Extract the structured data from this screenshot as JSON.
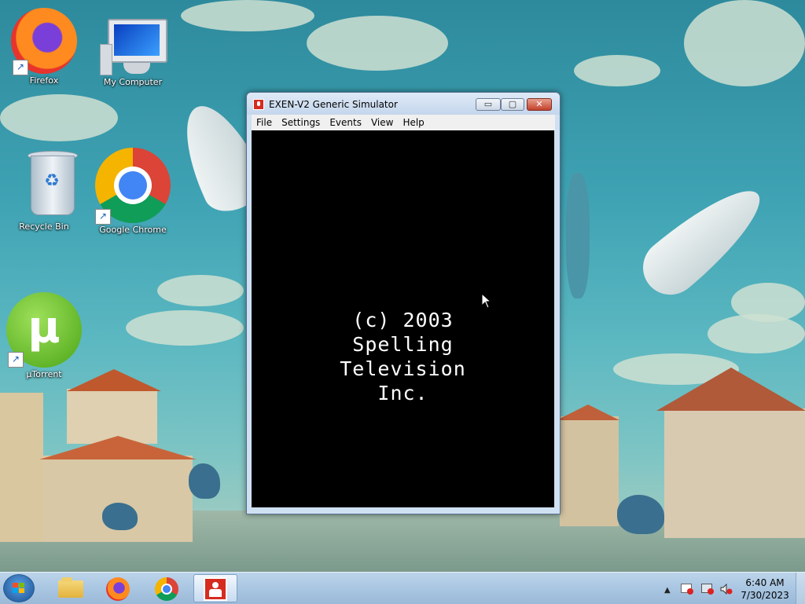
{
  "desktop": {
    "icons": [
      {
        "label": "Firefox",
        "icon": "firefox-icon"
      },
      {
        "label": "My Computer",
        "icon": "computer-icon"
      },
      {
        "label": "Recycle Bin",
        "icon": "recycle-bin-icon"
      },
      {
        "label": "Google Chrome",
        "icon": "chrome-icon"
      },
      {
        "label": "µTorrent",
        "icon": "utorrent-icon"
      }
    ]
  },
  "window": {
    "title": "EXEN-V2 Generic Simulator",
    "menu": [
      "File",
      "Settings",
      "Events",
      "View",
      "Help"
    ],
    "screen_lines": [
      "(c) 2003",
      "Spelling",
      "Television",
      "Inc."
    ],
    "controls": {
      "minimize": "▭",
      "maximize": "▢",
      "close": "✕"
    }
  },
  "taskbar": {
    "pinned": [
      "file-explorer-icon",
      "firefox-icon",
      "chrome-icon",
      "exen-simulator-icon"
    ],
    "tray_icons": [
      "show-hidden-icons-icon",
      "action-center-icon",
      "network-icon",
      "volume-muted-icon"
    ],
    "time": "6:40 AM",
    "date": "7/30/2023"
  },
  "colors": {
    "accent": "#d62b1f",
    "screen_bg": "#000000",
    "screen_fg": "#ffffff"
  }
}
